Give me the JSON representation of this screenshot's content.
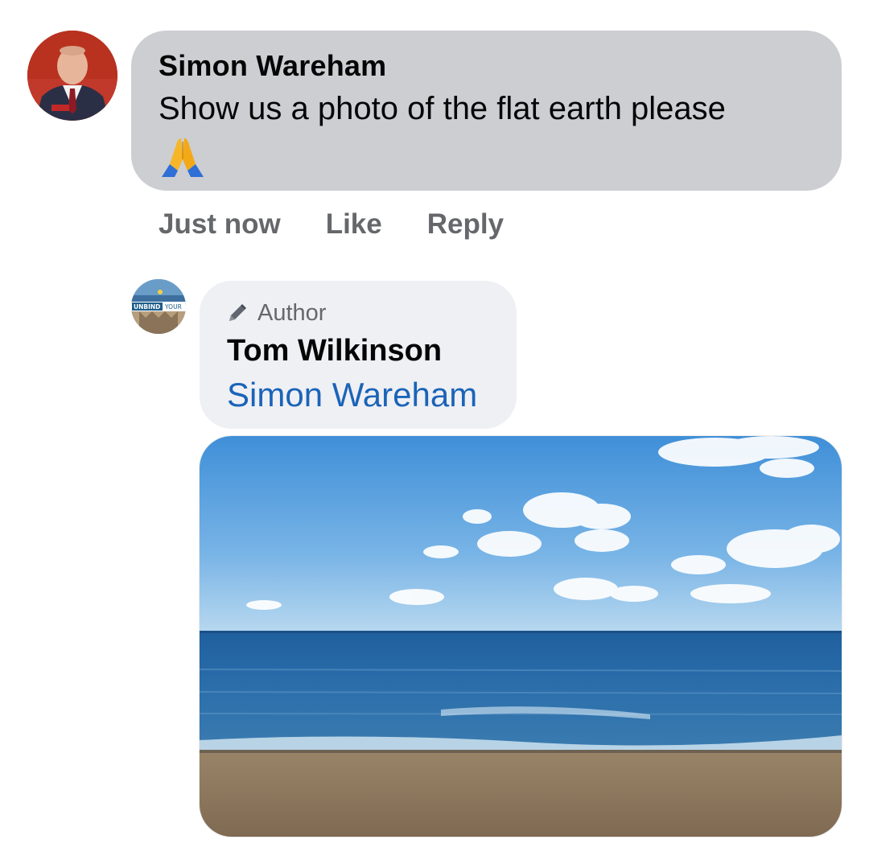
{
  "comment": {
    "author_name": "Simon Wareham",
    "text": "Show us a photo of the flat earth please",
    "emoji": "folded-hands-emoji",
    "timestamp": "Just now",
    "like_label": "Like",
    "reply_label": "Reply"
  },
  "reply": {
    "author_badge": "Author",
    "author_name": "Tom Wilkinson",
    "mention": "Simon Wareham",
    "avatar_text": "UNBIND YOUR"
  },
  "colors": {
    "bubble_grey": "#ccced2",
    "bubble_light": "#eff0f4",
    "action_text": "#65676b",
    "mention_blue": "#1b64b8"
  }
}
